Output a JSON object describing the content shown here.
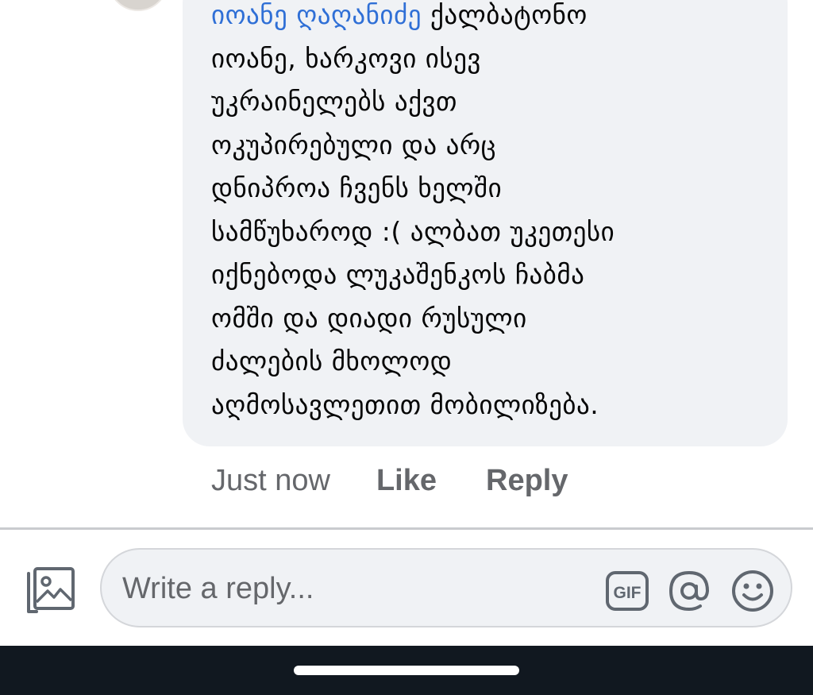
{
  "comment": {
    "author": "იოანე ღაღანიძე",
    "lines": [
      " ქალბატონო",
      "იოანე, ხარკოვი ისევ",
      "უკრაინელებს აქვთ",
      "ოკუპირებული და არც",
      "დნიპროა ჩვენს ხელში",
      "სამწუხაროდ :( ალბათ უკეთესი",
      "იქნებოდა ლუკაშენკოს ჩაბმა",
      "ომში და დიადი რუსული",
      "ძალების მხოლოდ",
      "აღმოსავლეთით მობილიზება."
    ]
  },
  "actions": {
    "time": "Just now",
    "like": "Like",
    "reply": "Reply"
  },
  "composer": {
    "placeholder": "Write a reply...",
    "gif_label": "GIF",
    "icons": [
      "photo-icon",
      "gif-icon",
      "at-icon",
      "smile-icon"
    ]
  },
  "colors": {
    "author_link": "#2f6fd6",
    "bubble_bg": "#f0f2f5",
    "meta_text": "#65676b",
    "nav_bar": "#111820"
  }
}
